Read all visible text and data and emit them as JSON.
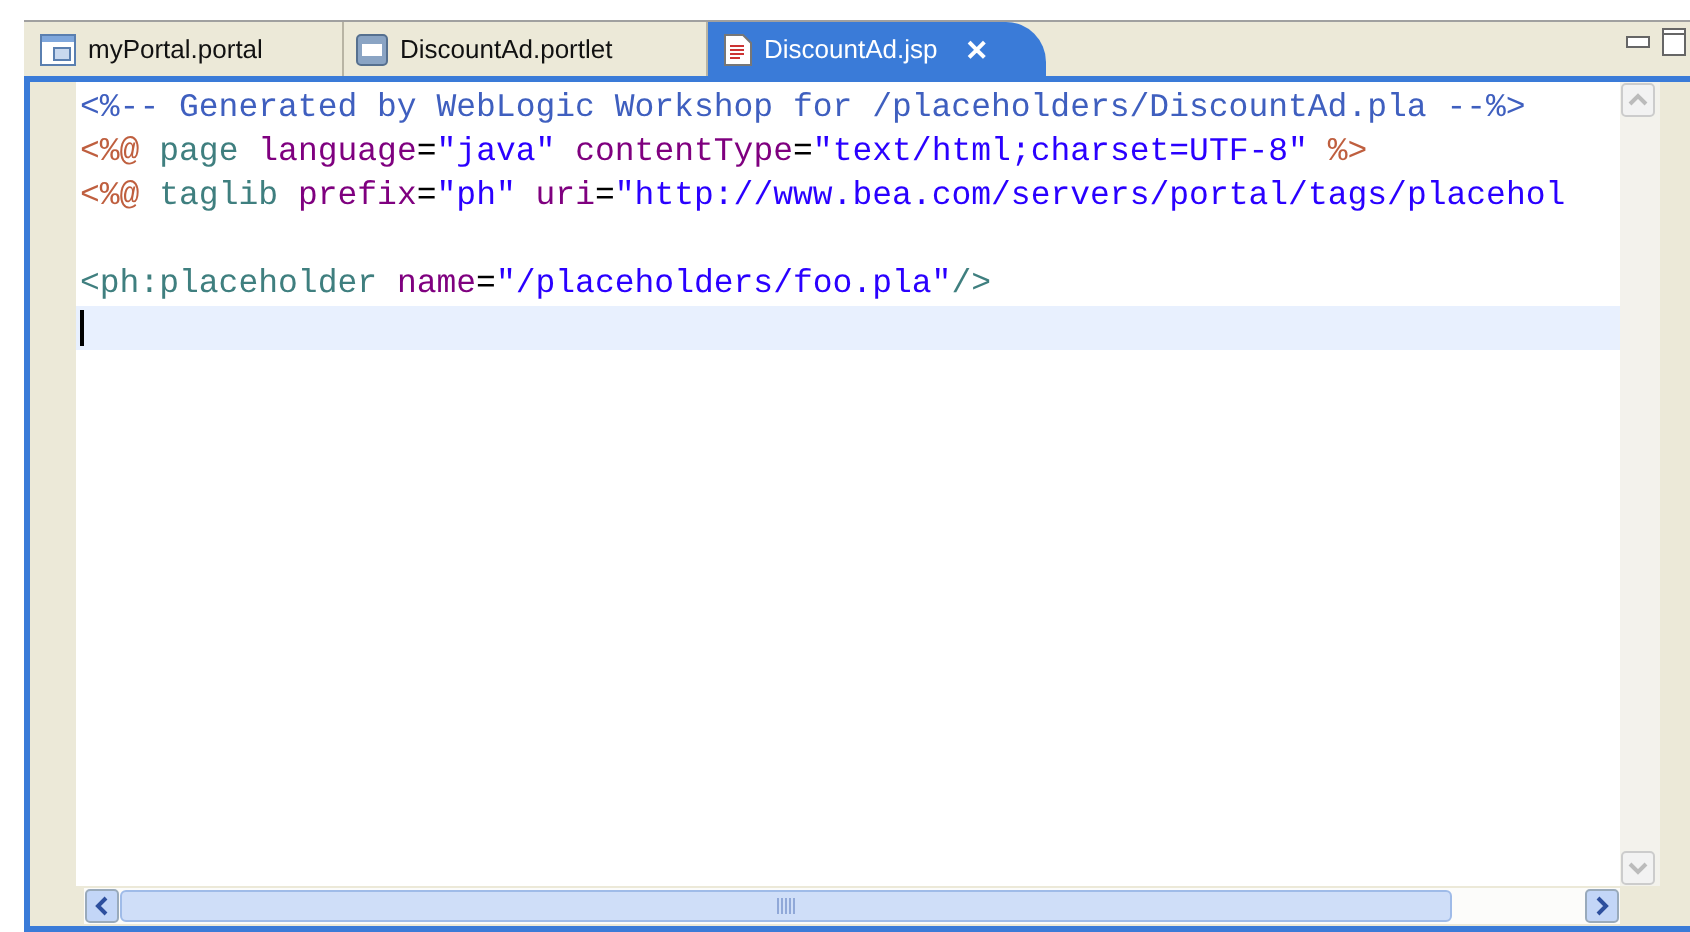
{
  "tabs": [
    {
      "label": "myPortal.portal",
      "kind": "portal",
      "selected": false
    },
    {
      "label": "DiscountAd.portlet",
      "kind": "portlet",
      "selected": false
    },
    {
      "label": "DiscountAd.jsp",
      "kind": "jsp",
      "selected": true,
      "close": "✕"
    }
  ],
  "editor": {
    "lines": [
      {
        "kind": "code",
        "tokens": [
          {
            "kind": "comment",
            "text": "<%-- Generated by WebLogic Workshop for /placeholders/DiscountAd.pla --%>"
          }
        ]
      },
      {
        "kind": "code",
        "tokens": [
          {
            "kind": "delim",
            "text": "<%@"
          },
          {
            "kind": "tag",
            "text": " page "
          },
          {
            "kind": "attr",
            "text": "language"
          },
          {
            "kind": "plain",
            "text": "="
          },
          {
            "kind": "value",
            "text": "\"java\""
          },
          {
            "kind": "attr",
            "text": " contentType"
          },
          {
            "kind": "plain",
            "text": "="
          },
          {
            "kind": "value",
            "text": "\"text/html;charset=UTF-8\""
          },
          {
            "kind": "delim",
            "text": " %>"
          }
        ]
      },
      {
        "kind": "code",
        "tokens": [
          {
            "kind": "delim",
            "text": "<%@"
          },
          {
            "kind": "tag",
            "text": " taglib "
          },
          {
            "kind": "attr",
            "text": "prefix"
          },
          {
            "kind": "plain",
            "text": "="
          },
          {
            "kind": "value",
            "text": "\"ph\""
          },
          {
            "kind": "attr",
            "text": " uri"
          },
          {
            "kind": "plain",
            "text": "="
          },
          {
            "kind": "value",
            "text": "\"http://www.bea.com/servers/portal/tags/placehol"
          }
        ]
      },
      {
        "kind": "blank"
      },
      {
        "kind": "code",
        "tokens": [
          {
            "kind": "tag",
            "text": "<ph:placeholder "
          },
          {
            "kind": "attr",
            "text": "name"
          },
          {
            "kind": "plain",
            "text": "="
          },
          {
            "kind": "value",
            "text": "\"/placeholders/foo.pla\""
          },
          {
            "kind": "tag",
            "text": "/>"
          }
        ]
      },
      {
        "kind": "cursor"
      }
    ]
  }
}
